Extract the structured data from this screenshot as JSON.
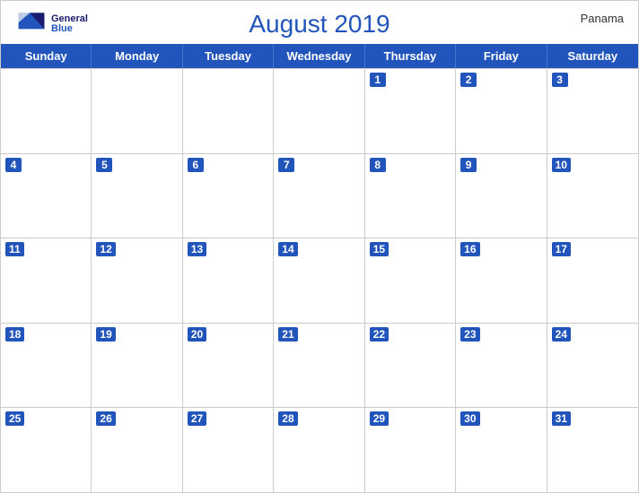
{
  "header": {
    "title": "August 2019",
    "country": "Panama",
    "logo": {
      "line1": "General",
      "line2": "Blue"
    }
  },
  "days_of_week": [
    "Sunday",
    "Monday",
    "Tuesday",
    "Wednesday",
    "Thursday",
    "Friday",
    "Saturday"
  ],
  "weeks": [
    [
      {
        "number": "",
        "empty": true
      },
      {
        "number": "",
        "empty": true
      },
      {
        "number": "",
        "empty": true
      },
      {
        "number": "",
        "empty": true
      },
      {
        "number": "1",
        "empty": false
      },
      {
        "number": "2",
        "empty": false
      },
      {
        "number": "3",
        "empty": false
      }
    ],
    [
      {
        "number": "4",
        "empty": false
      },
      {
        "number": "5",
        "empty": false
      },
      {
        "number": "6",
        "empty": false
      },
      {
        "number": "7",
        "empty": false
      },
      {
        "number": "8",
        "empty": false
      },
      {
        "number": "9",
        "empty": false
      },
      {
        "number": "10",
        "empty": false
      }
    ],
    [
      {
        "number": "11",
        "empty": false
      },
      {
        "number": "12",
        "empty": false
      },
      {
        "number": "13",
        "empty": false
      },
      {
        "number": "14",
        "empty": false
      },
      {
        "number": "15",
        "empty": false
      },
      {
        "number": "16",
        "empty": false
      },
      {
        "number": "17",
        "empty": false
      }
    ],
    [
      {
        "number": "18",
        "empty": false
      },
      {
        "number": "19",
        "empty": false
      },
      {
        "number": "20",
        "empty": false
      },
      {
        "number": "21",
        "empty": false
      },
      {
        "number": "22",
        "empty": false
      },
      {
        "number": "23",
        "empty": false
      },
      {
        "number": "24",
        "empty": false
      }
    ],
    [
      {
        "number": "25",
        "empty": false
      },
      {
        "number": "26",
        "empty": false
      },
      {
        "number": "27",
        "empty": false
      },
      {
        "number": "28",
        "empty": false
      },
      {
        "number": "29",
        "empty": false
      },
      {
        "number": "30",
        "empty": false
      },
      {
        "number": "31",
        "empty": false
      }
    ]
  ],
  "colors": {
    "header_bg": "#2255bb",
    "accent": "#2255bb",
    "text_white": "#ffffff",
    "border": "#cccccc"
  }
}
